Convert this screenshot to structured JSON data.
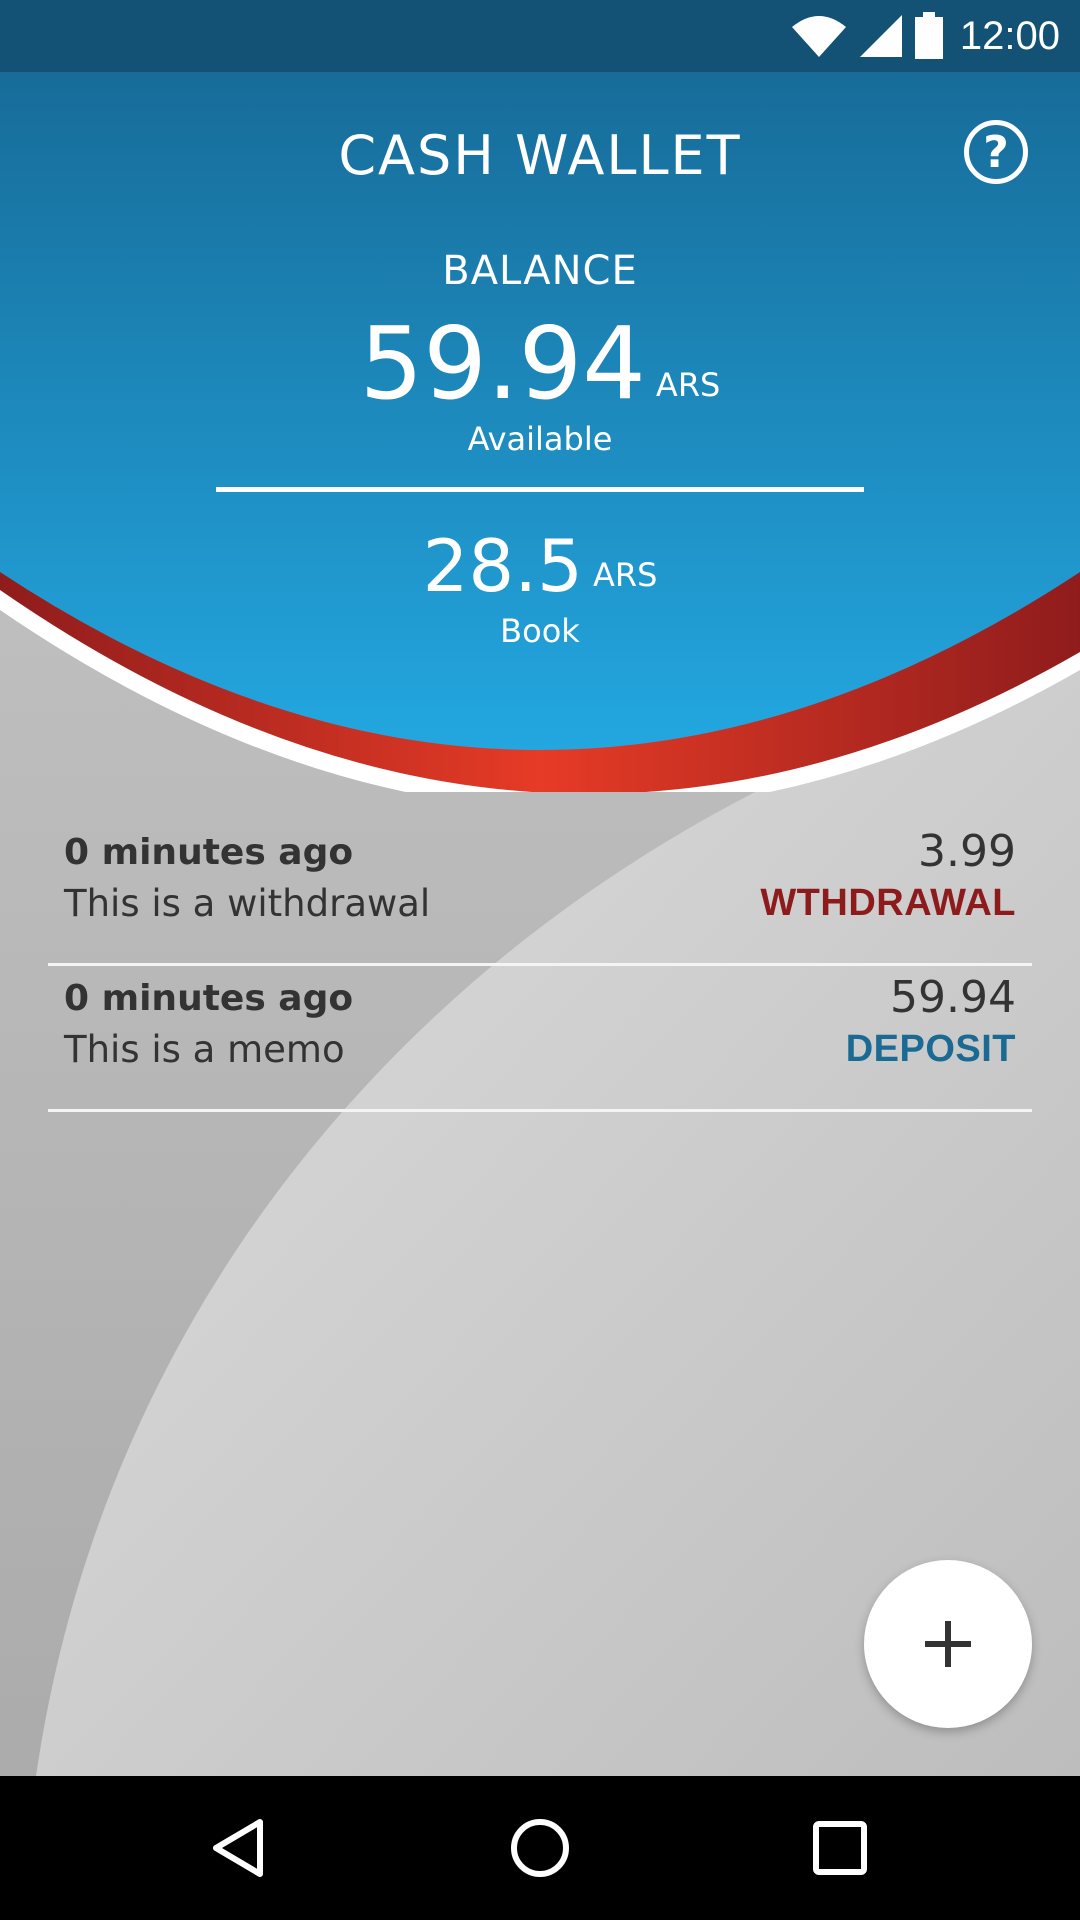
{
  "status_bar": {
    "time": "12:00"
  },
  "header": {
    "title": "CASH WALLET",
    "help_icon": "help-circle-icon",
    "balance_label": "BALANCE",
    "available_amount": "59.94",
    "available_currency": "ARS",
    "available_label": "Available",
    "book_amount": "28.5",
    "book_currency": "ARS",
    "book_label": "Book"
  },
  "transactions": [
    {
      "time": "0 minutes ago",
      "memo": "This is a withdrawal",
      "amount": "3.99",
      "type": "WTHDRAWAL",
      "type_color": "#8e1b1b"
    },
    {
      "time": "0 minutes ago",
      "memo": "This is a memo",
      "amount": "59.94",
      "type": "DEPOSIT",
      "type_color": "#1a6a93"
    }
  ],
  "fab": {
    "icon": "plus-icon"
  },
  "nav": {
    "back_icon": "back-triangle-icon",
    "home_icon": "home-circle-icon",
    "recents_icon": "recents-square-icon"
  },
  "colors": {
    "header_top": "#176c99",
    "header_bottom": "#22a6df",
    "accent_red": "#b62a22"
  }
}
